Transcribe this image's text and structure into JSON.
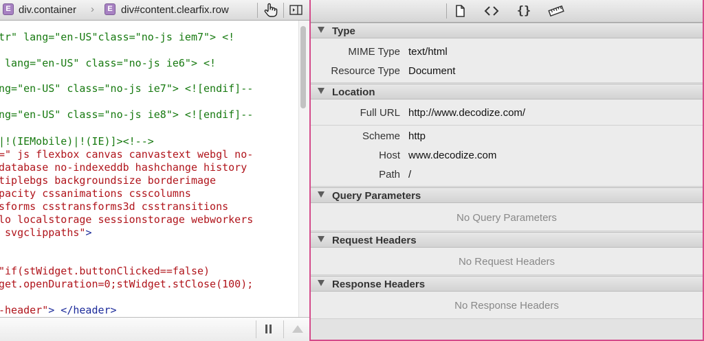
{
  "breadcrumb": {
    "items": [
      {
        "badge": "E",
        "label": "div.container"
      },
      {
        "badge": "E",
        "label": "div#content.clearfix.row"
      }
    ]
  },
  "code_lines": [
    {
      "parts": [
        {
          "t": "tr\" lang=\"en-US\"class=\"no-js iem7\"> <!",
          "c": "green"
        }
      ]
    },
    {
      "parts": [
        {
          "t": " lang=\"en-US\" class=\"no-js ie6\"> <!",
          "c": "green"
        }
      ]
    },
    {
      "parts": [
        {
          "t": "ng=\"en-US\" class=\"no-js ie7\"> <![endif]--",
          "c": "green"
        }
      ]
    },
    {
      "parts": [
        {
          "t": "ng=\"en-US\" class=\"no-js ie8\"> <![endif]--",
          "c": "green"
        }
      ]
    },
    {
      "parts": [
        {
          "t": "|!(IEMobile)|!(IE)]><!-->",
          "c": "green"
        }
      ]
    },
    {
      "parts": [
        {
          "t": "=\" js flexbox canvas canvastext webgl no-",
          "c": "red"
        }
      ]
    },
    {
      "parts": [
        {
          "t": "database no-indexeddb hashchange history",
          "c": "red"
        }
      ]
    },
    {
      "parts": [
        {
          "t": "tiplebgs backgroundsize borderimage",
          "c": "red"
        }
      ]
    },
    {
      "parts": [
        {
          "t": "pacity cssanimations csscolumns",
          "c": "red"
        }
      ]
    },
    {
      "parts": [
        {
          "t": "sforms csstransforms3d csstransitions",
          "c": "red"
        }
      ]
    },
    {
      "parts": [
        {
          "t": "lo localstorage sessionstorage webworkers",
          "c": "red"
        }
      ]
    },
    {
      "parts": [
        {
          "t": " svgclippaths\"",
          "c": "red"
        },
        {
          "t": ">",
          "c": "blue"
        }
      ]
    },
    {
      "parts": [
        {
          "t": "\"if(stWidget.buttonClicked==false)",
          "c": "red"
        }
      ]
    },
    {
      "parts": [
        {
          "t": "get.openDuration=0;stWidget.stClose(100);",
          "c": "red"
        }
      ]
    },
    {
      "parts": [
        {
          "t": "-header\"",
          "c": "red"
        },
        {
          "t": "> </header>",
          "c": "blue"
        }
      ]
    }
  ],
  "sections": {
    "type": {
      "title": "Type",
      "rows": [
        {
          "label": "MIME Type",
          "value": "text/html"
        },
        {
          "label": "Resource Type",
          "value": "Document"
        }
      ]
    },
    "location": {
      "title": "Location",
      "full_url_label": "Full URL",
      "full_url_value": "http://www.decodize.com/",
      "rows": [
        {
          "label": "Scheme",
          "value": "http"
        },
        {
          "label": "Host",
          "value": "www.decodize.com"
        },
        {
          "label": "Path",
          "value": "/"
        }
      ]
    },
    "query": {
      "title": "Query Parameters",
      "empty": "No Query Parameters"
    },
    "request": {
      "title": "Request Headers",
      "empty": "No Request Headers"
    },
    "response": {
      "title": "Response Headers",
      "empty": "No Response Headers"
    }
  },
  "icons": {
    "breadcrumb_sep": "chevron-right-icon",
    "pointer": "hand-pointer-icon",
    "toggle_sidebar": "sidebar-toggle-icon",
    "toolbar": [
      "document-icon",
      "code-brackets-icon",
      "curly-braces-icon",
      "ruler-icon"
    ],
    "pause": "pause-icon",
    "scroll_up": "triangle-up-icon"
  },
  "colors": {
    "accent_border": "#d44a8a",
    "attr_green": "#16790f",
    "string_red": "#b0141b",
    "tag_blue": "#1b2a9a"
  }
}
